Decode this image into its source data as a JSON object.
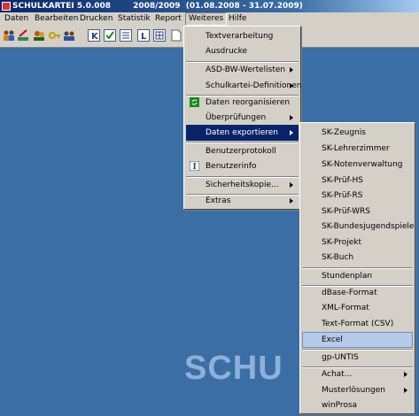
{
  "window": {
    "title": "SCHULKARTEI 5.0.008        2008/2009  (01.08.2008 - 31.07.2009)"
  },
  "menubar": [
    "Daten",
    "Bearbeiten",
    "Drucken",
    "Statistik",
    "Report",
    "Weiteres",
    "Hilfe"
  ],
  "toolbar_icons": [
    "people-icon",
    "pen-icon",
    "users-icon",
    "key-icon",
    "group-icon",
    "k-icon",
    "check-icon",
    "list-icon",
    "l-icon",
    "table-icon",
    "page-icon"
  ],
  "weiteres_menu": {
    "items": [
      "Textverarbeitung",
      "Ausdrucke",
      "ASD-BW-Wertelisten",
      "Schulkartei-Definitionen",
      "Daten reorganisieren",
      "Überprüfungen",
      "Daten exportieren",
      "Benutzerprotokoll",
      "Benutzerinfo",
      "Sicherheitskopie...",
      "Extras"
    ]
  },
  "export_menu": {
    "items": [
      "SK-Zeugnis",
      "SK-Lehrerzimmer",
      "SK-Notenverwaltung",
      "SK-Prüf-HS",
      "SK-Prüf-RS",
      "SK-Prüf-WRS",
      "SK-Bundesjugendspiele",
      "SK-Projekt",
      "SK-Buch",
      "Stundenplan",
      "dBase-Format",
      "XML-Format",
      "Text-Format (CSV)",
      "Excel",
      "gp-UNTIS",
      "Achat...",
      "Musterlösungen",
      "winProsa"
    ]
  },
  "watermark": "SCHU",
  "colors": {
    "desktop": "#3a6ea5",
    "menu_bg": "#d4d0c8",
    "selection": "#0a246a",
    "hover": "#b6cbea"
  }
}
